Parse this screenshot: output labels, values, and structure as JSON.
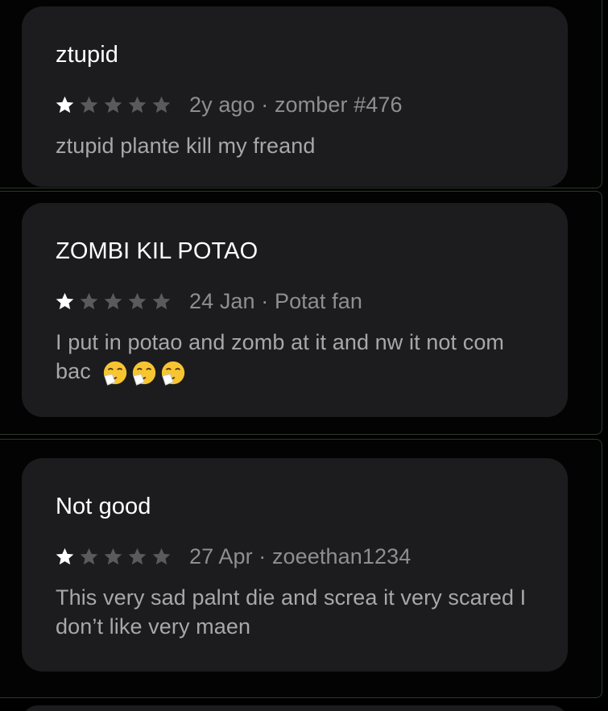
{
  "reviews": [
    {
      "title": "ztupid",
      "rating": 1,
      "max_rating": 5,
      "meta": "2y ago · zomber #476",
      "body": "ztupid plante kill my freand"
    },
    {
      "title": "ZOMBI KIL POTAO",
      "rating": 1,
      "max_rating": 5,
      "meta": "24 Jan · Potat fan",
      "body": "I put in potao and zomb at it and nw it not com bac",
      "emoji": [
        "sneezing-face",
        "sneezing-face",
        "sneezing-face"
      ]
    },
    {
      "title": "Not good",
      "rating": 1,
      "max_rating": 5,
      "meta": "27 Apr · zoeethan1234",
      "body": "This very sad palnt die and screa it very scared I don’t like very maen"
    }
  ],
  "colors": {
    "background": "#000000",
    "card": "#1c1c1e",
    "title": "#ffffff",
    "meta": "#8e8e93",
    "body": "#a7a7ac",
    "star_filled": "#ffffff",
    "star_empty": "#5a5a5e",
    "panel_border": "#2a3a2a"
  }
}
